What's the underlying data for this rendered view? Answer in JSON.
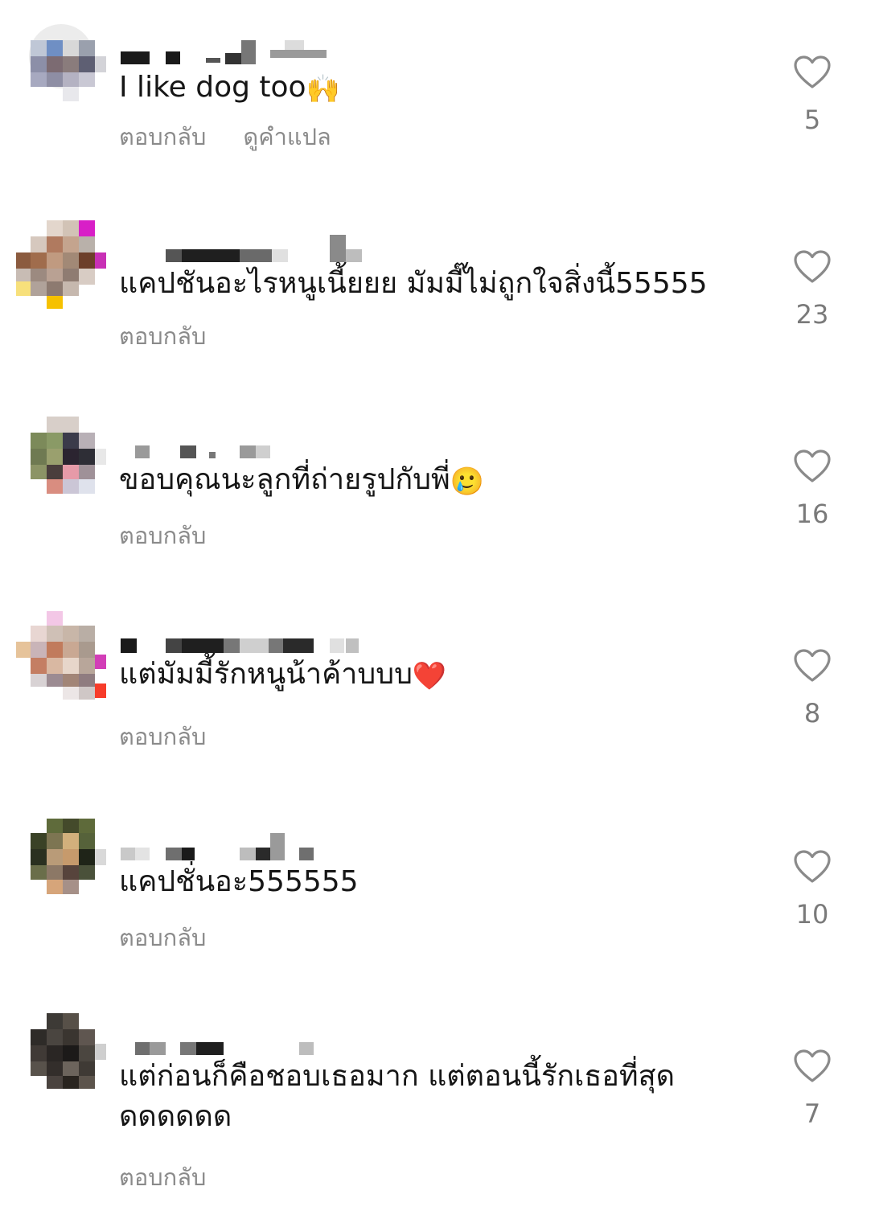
{
  "comments": [
    {
      "text": "I like dog too",
      "emoji": "🙌",
      "reply_label": "ตอบกลับ",
      "translate_label": "ดูคำแปล",
      "likes": "5"
    },
    {
      "text": "แคปชันอะไรหนูเนี้ยยย มัมมี๊ไม่ถูกใจสิ่งนี้55555",
      "emoji": "",
      "reply_label": "ตอบกลับ",
      "likes": "23"
    },
    {
      "text": "ขอบคุณนะลูกที่ถ่ายรูปกับพี่",
      "emoji": "🥲",
      "reply_label": "ตอบกลับ",
      "likes": "16"
    },
    {
      "text": "แต่มัมมี้รักหนูน้าค้าบบบ",
      "emoji": "❤️",
      "reply_label": "ตอบกลับ",
      "likes": "8"
    },
    {
      "text": "แคปชั่นอะ555555",
      "emoji": "",
      "reply_label": "ตอบกลับ",
      "likes": "10"
    },
    {
      "text": "แต่ก่อนก็คือชอบเธอมาก แต่ตอนนี้รักเธอที่สุด\nดดดดดด",
      "emoji": "",
      "reply_label": "ตอบกลับ",
      "likes": "7"
    }
  ],
  "icons": {
    "like": "heart-outline-icon",
    "avatar": "pixelated-avatar",
    "username": "pixelated-username"
  },
  "colors": {
    "text": "#161616",
    "muted": "#8a8a8a",
    "count": "#7a7a7a",
    "background": "#ffffff"
  }
}
